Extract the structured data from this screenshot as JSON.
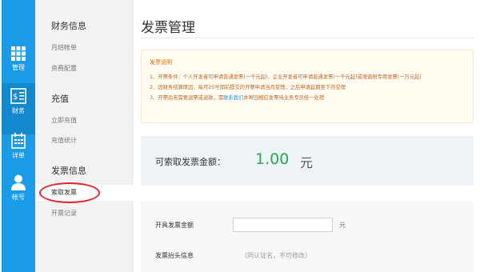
{
  "rail": [
    {
      "label": "管理",
      "icon": "grid-icon"
    },
    {
      "label": "财务",
      "icon": "finance-icon",
      "active": true
    },
    {
      "label": "详单",
      "icon": "calendar-icon"
    },
    {
      "label": "帐号",
      "icon": "user-icon"
    }
  ],
  "subnav": {
    "groups": [
      {
        "title": "财务信息",
        "items": [
          "月结帐单",
          "资费配置"
        ]
      },
      {
        "title": "充值",
        "items": [
          "立即充值",
          "充值统计"
        ]
      },
      {
        "title": "发票信息",
        "items": [
          "索取发票",
          "开票记录"
        ]
      }
    ],
    "active_item": "索取发票"
  },
  "page": {
    "title": "发票管理"
  },
  "notice": {
    "title": "发票说明",
    "line1": "1、开票条件：个人开发者可申请普通发票(一千元起)，企业开发者可申请普通发票(一千元起)或增值税专用发票(一万元起)",
    "line2": "2、因财务结算原因，每月25号期前提交的开票申请当月受理，之后申请延期至下月受理",
    "line3_prefix": "3、开票后若需要退票或退款，需",
    "line3_link": "联系我们",
    "line3_suffix": "并寄回相应发票待业务专员统一处理"
  },
  "amount": {
    "label": "可索取发票金额：",
    "value": "1.00",
    "unit": "元"
  },
  "form": {
    "amount_label": "开具发票金额",
    "amount_value": "",
    "amount_unit": "元",
    "header_label": "发票抬头信息",
    "header_hint": "（同认证名，不可修改）"
  },
  "colors": {
    "rail": "#1a9be6",
    "amount": "#27a84a",
    "notice_text": "#b5682a",
    "highlight_circle": "#e0262a"
  }
}
